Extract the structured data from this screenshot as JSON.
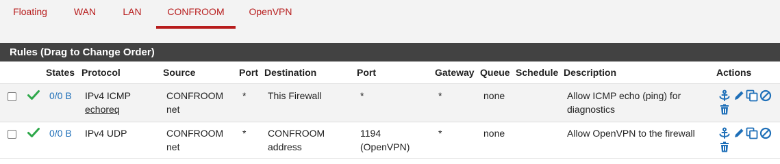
{
  "tabs": [
    {
      "label": "Floating"
    },
    {
      "label": "WAN"
    },
    {
      "label": "LAN"
    },
    {
      "label": "CONFROOM",
      "active": true
    },
    {
      "label": "OpenVPN"
    }
  ],
  "panel": {
    "title": "Rules (Drag to Change Order)"
  },
  "table": {
    "headers": {
      "states": "States",
      "protocol": "Protocol",
      "source": "Source",
      "source_port": "Port",
      "destination": "Destination",
      "dest_port": "Port",
      "gateway": "Gateway",
      "queue": "Queue",
      "schedule": "Schedule",
      "description": "Description",
      "actions": "Actions"
    },
    "rows": [
      {
        "states": "0/0 B",
        "protocol": "IPv4 ICMP",
        "protocol_sub": "echoreq",
        "source_1": "CONFROOM",
        "source_2": "net",
        "source_port": "*",
        "destination_1": "This Firewall",
        "destination_2": "",
        "dest_port_1": "*",
        "dest_port_2": "",
        "gateway": "*",
        "queue": "none",
        "schedule": "",
        "description_1": "Allow ICMP echo (ping) for",
        "description_2": "diagnostics"
      },
      {
        "states": "0/0 B",
        "protocol": "IPv4 UDP",
        "protocol_sub": "",
        "source_1": "CONFROOM",
        "source_2": "net",
        "source_port": "*",
        "destination_1": "CONFROOM",
        "destination_2": "address",
        "dest_port_1": "1194",
        "dest_port_2": "(OpenVPN)",
        "gateway": "*",
        "queue": "none",
        "schedule": "",
        "description_1": "Allow OpenVPN to the firewall",
        "description_2": ""
      }
    ]
  },
  "colors": {
    "accent": "#b71c1c",
    "link": "#1e6fb8",
    "pass": "#2ea84a",
    "header_bg": "#424242"
  },
  "icons": [
    "checkmark-icon",
    "anchor-icon",
    "pencil-icon",
    "copy-icon",
    "disable-icon",
    "trash-icon"
  ]
}
